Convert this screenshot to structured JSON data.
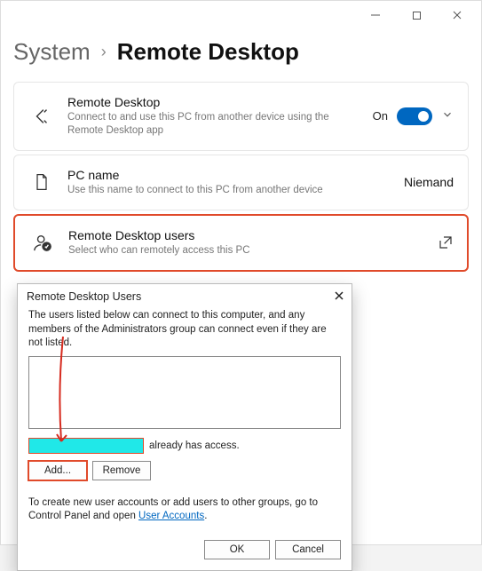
{
  "titlebar": {
    "minimize": "—",
    "maximize": "☐",
    "close": "✕"
  },
  "breadcrumb": {
    "system": "System",
    "chevron": "›",
    "title": "Remote Desktop"
  },
  "cards": {
    "rd": {
      "title": "Remote Desktop",
      "sub": "Connect to and use this PC from another device using the Remote Desktop app",
      "on": "On"
    },
    "pcname": {
      "title": "PC name",
      "sub": "Use this name to connect to this PC from another device",
      "value": "Niemand"
    },
    "users": {
      "title": "Remote Desktop users",
      "sub": "Select who can remotely access this PC"
    }
  },
  "dialog": {
    "title": "Remote Desktop Users",
    "desc": "The users listed below can connect to this computer, and any members of the Administrators group can connect even if they are not listed.",
    "accessSuffix": "already has access.",
    "add": "Add...",
    "remove": "Remove",
    "hintPrefix": "To create new user accounts or add users to other groups, go to Control Panel and open ",
    "hintLink": "User Accounts",
    "hintSuffix": ".",
    "ok": "OK",
    "cancel": "Cancel"
  }
}
